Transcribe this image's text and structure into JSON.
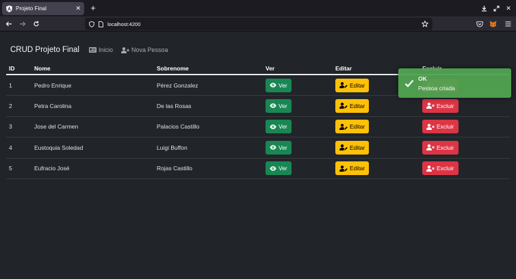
{
  "browser": {
    "tab_title": "Projeto Final",
    "url": "localhost:4200"
  },
  "app": {
    "brand": "CRUD Projeto Final",
    "nav": [
      {
        "label": "Inicio",
        "icon": "id-card-icon"
      },
      {
        "label": "Nova Pessoa",
        "icon": "user-plus-icon"
      }
    ]
  },
  "table": {
    "headers": [
      "ID",
      "Nome",
      "Sobrenome",
      "Ver",
      "Editar",
      "Excluir"
    ],
    "rows": [
      {
        "id": "1",
        "nome": "Pedro Enrique",
        "sobrenome": "Pérez Gonzalez"
      },
      {
        "id": "2",
        "nome": "Petra Carolina",
        "sobrenome": "De las Rosas"
      },
      {
        "id": "3",
        "nome": "Jose del Carmen",
        "sobrenome": "Palacios Castillo"
      },
      {
        "id": "4",
        "nome": "Eustoquia Soledad",
        "sobrenome": "Luigi Buffon"
      },
      {
        "id": "5",
        "nome": "Eufracio José",
        "sobrenome": "Rojas Castillo"
      }
    ],
    "buttons": {
      "ver": "Ver",
      "editar": "Editar",
      "excluir": "Excluir"
    }
  },
  "toast": {
    "title": "OK",
    "message": "Pessoa criada"
  },
  "colors": {
    "ver": "#198754",
    "editar": "#ffc107",
    "excluir": "#dc3545",
    "toast": "#51a351"
  }
}
